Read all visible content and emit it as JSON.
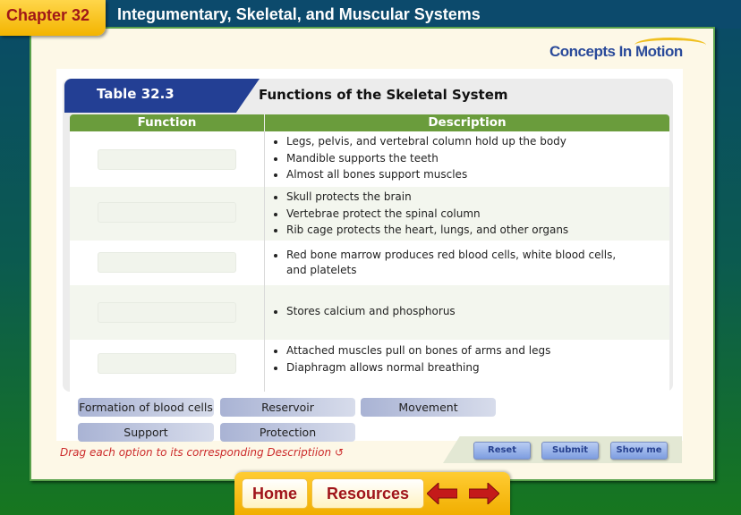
{
  "header": {
    "chapter": "Chapter 32",
    "title": "Integumentary, Skeletal, and Muscular Systems",
    "logo": "Concepts In Motion"
  },
  "table": {
    "tab_label": "Table 32.3",
    "title": "Functions of the Skeletal System",
    "columns": [
      "Function",
      "Description"
    ],
    "rows": [
      {
        "function": "",
        "description": [
          "Legs, pelvis, and vertebral column hold up the body",
          "Mandible supports the teeth",
          "Almost all bones support muscles"
        ]
      },
      {
        "function": "",
        "description": [
          "Skull protects the brain",
          "Vertebrae protect the spinal column",
          "Rib cage protects the heart, lungs, and other organs"
        ]
      },
      {
        "function": "",
        "description": [
          "Red bone marrow produces red blood cells, white blood cells, and platelets"
        ]
      },
      {
        "function": "",
        "description": [
          "Stores calcium and phosphorus"
        ]
      },
      {
        "function": "",
        "description": [
          "Attached muscles pull on bones of arms and legs",
          "Diaphragm allows normal breathing"
        ]
      }
    ]
  },
  "options": [
    "Formation of blood cells",
    "Reservoir",
    "Movement",
    "Support",
    "Protection"
  ],
  "instruction": "Drag each option to its corresponding Descriptiion",
  "buttons": {
    "reset": "Reset",
    "submit": "Submit",
    "show_me": "Show me"
  },
  "nav": {
    "home": "Home",
    "resources": "Resources"
  },
  "colors": {
    "header_green": "#6a9c3c",
    "tab_blue": "#233f94",
    "chapter_red": "#a01818",
    "instruction_red": "#cc2a2a"
  }
}
